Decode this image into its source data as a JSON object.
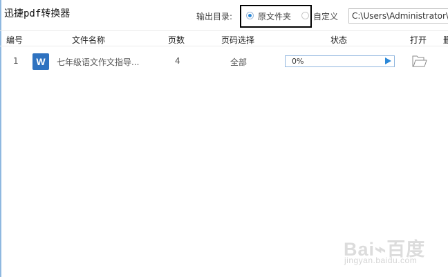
{
  "app_title": "迅捷pdf转换器",
  "output": {
    "label": "输出目录:",
    "option_original": "原文件夹",
    "option_custom": "自定义",
    "path": "C:\\Users\\Administrator\\"
  },
  "table": {
    "columns": [
      "编号",
      "文件名称",
      "页数",
      "页码选择",
      "状态",
      "打开",
      "删"
    ],
    "rows": [
      {
        "index": "1",
        "file_icon": "word-icon",
        "file_name": "七年级语文作文指导...",
        "pages": "4",
        "page_range": "全部",
        "status_progress": 0,
        "status_text": "0%",
        "open_icon": "folder-icon"
      }
    ]
  },
  "watermark": {
    "main": "Bai⌁百度",
    "sub": "jingyan.baidu.com"
  },
  "colors": {
    "accent": "#2b88d8",
    "word_icon": "#2e72c0",
    "progress_border": "#8fb5de",
    "highlight_box": "#000000"
  }
}
